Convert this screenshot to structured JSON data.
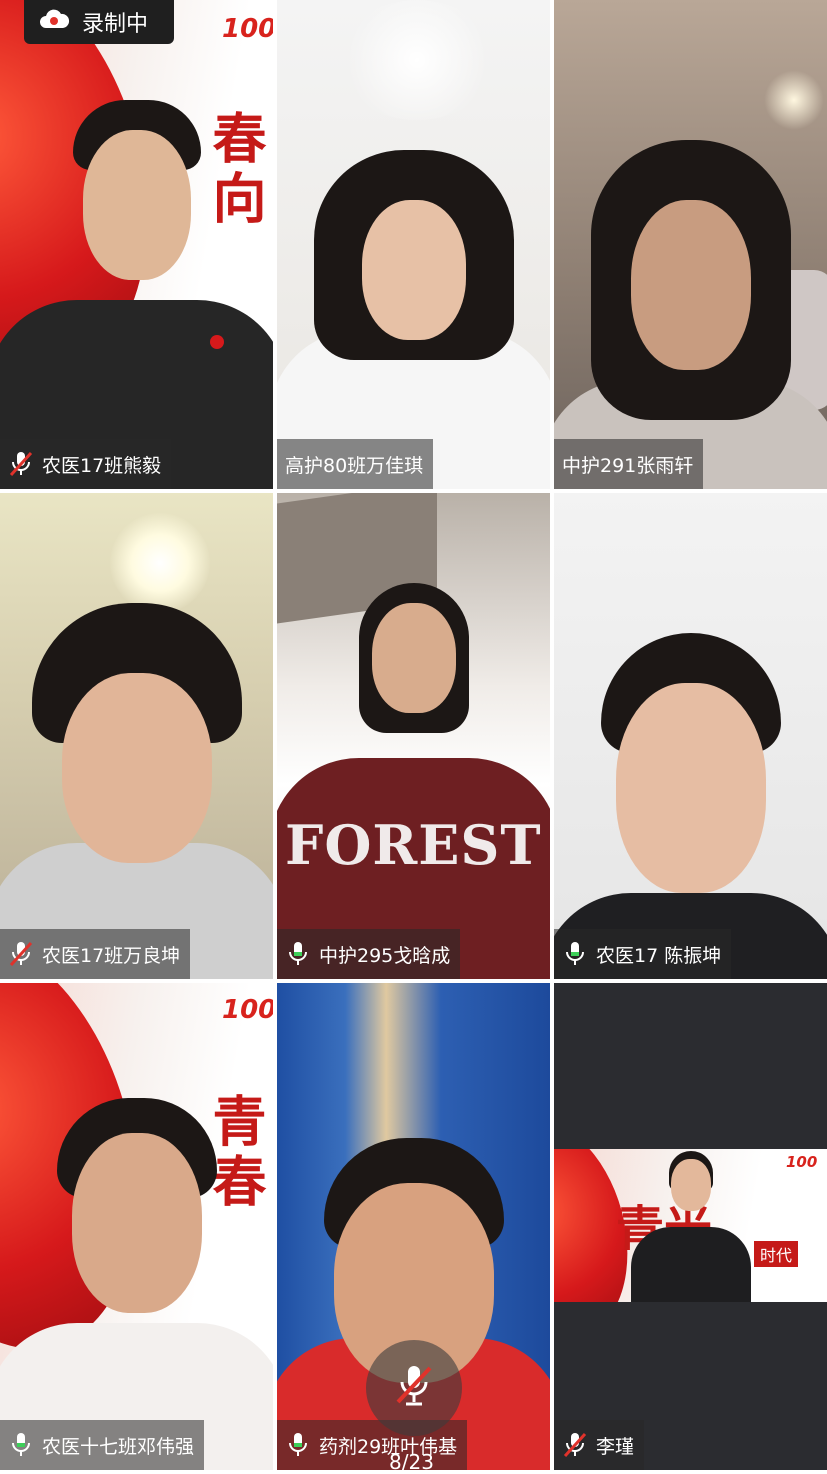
{
  "recording": {
    "label": "录制中"
  },
  "participants": [
    {
      "name": "农医17班熊毅",
      "mic": "muted"
    },
    {
      "name": "高护80班万佳琪",
      "mic": "none"
    },
    {
      "name": "中护291张雨轩",
      "mic": "none"
    },
    {
      "name": "农医17班万良坤",
      "mic": "muted"
    },
    {
      "name": "中护295戈晗成",
      "mic": "on"
    },
    {
      "name": "农医17 陈振坤",
      "mic": "on"
    },
    {
      "name": "农医十七班邓伟强",
      "mic": "on"
    },
    {
      "name": "药剂29班叶伟基",
      "mic": "on"
    },
    {
      "name": "李瑾",
      "mic": "muted"
    }
  ],
  "banner": {
    "logo": "100",
    "chars_a": "春向",
    "chars_b": "青春",
    "chars_c": "青光",
    "tagline": "时代"
  },
  "shirt_text": "FOREST",
  "page_indicator": "8/23",
  "colors": {
    "accent_red": "#d6191b",
    "label_bg": "rgba(40,40,40,0.55)"
  }
}
